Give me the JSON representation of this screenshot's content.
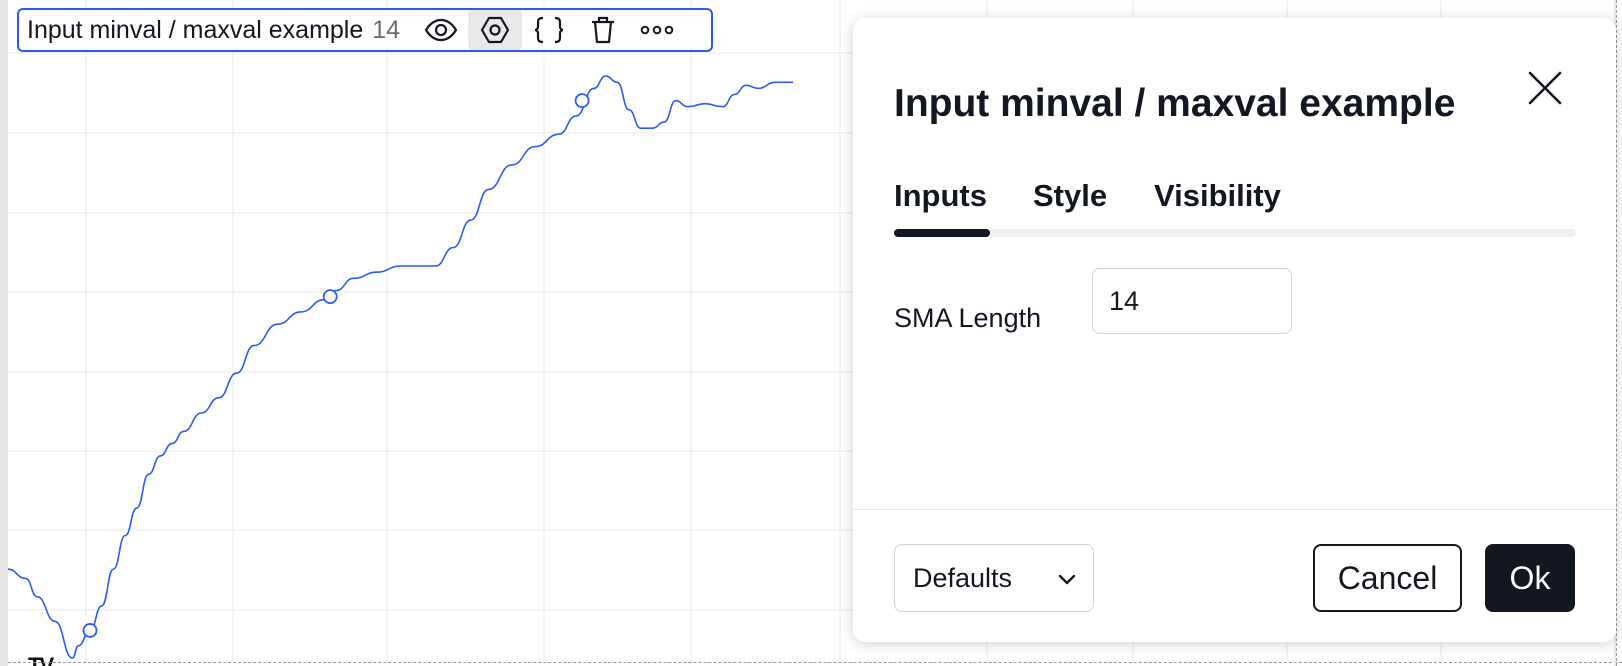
{
  "legend": {
    "title": "Input minval / maxval example",
    "value": "14",
    "buttons": [
      {
        "name": "eye-icon",
        "active": false
      },
      {
        "name": "settings-icon",
        "active": true
      },
      {
        "name": "source-code-icon",
        "active": false
      },
      {
        "name": "trash-icon",
        "active": false
      },
      {
        "name": "more-icon",
        "active": false
      }
    ]
  },
  "chart_data": {
    "type": "line",
    "title": "",
    "series": [
      {
        "color": "#2c5bf0",
        "points": [
          [
            0,
            0.145
          ],
          [
            3,
            0.13
          ],
          [
            5,
            0.1
          ],
          [
            8,
            0.06
          ],
          [
            11,
            0.0
          ],
          [
            12,
            0.02
          ],
          [
            14,
            0.045
          ],
          [
            16,
            0.085
          ],
          [
            18,
            0.145
          ],
          [
            20,
            0.2
          ],
          [
            22,
            0.245
          ],
          [
            24,
            0.3
          ],
          [
            26,
            0.33
          ],
          [
            28,
            0.35
          ],
          [
            30,
            0.37
          ],
          [
            33,
            0.4
          ],
          [
            36,
            0.425
          ],
          [
            39,
            0.465
          ],
          [
            42,
            0.51
          ],
          [
            46,
            0.545
          ],
          [
            50,
            0.565
          ],
          [
            54,
            0.585
          ],
          [
            56,
            0.6
          ],
          [
            59,
            0.62
          ],
          [
            63,
            0.63
          ],
          [
            67,
            0.64
          ],
          [
            70,
            0.64
          ],
          [
            73,
            0.64
          ],
          [
            76,
            0.67
          ],
          [
            79,
            0.715
          ],
          [
            82,
            0.765
          ],
          [
            86,
            0.805
          ],
          [
            90,
            0.835
          ],
          [
            94,
            0.855
          ],
          [
            97,
            0.885
          ],
          [
            100,
            0.93
          ],
          [
            102,
            0.95
          ],
          [
            104,
            0.94
          ],
          [
            106,
            0.895
          ],
          [
            108,
            0.865
          ],
          [
            110,
            0.865
          ],
          [
            112,
            0.875
          ],
          [
            114,
            0.91
          ],
          [
            116,
            0.9
          ],
          [
            119,
            0.905
          ],
          [
            122,
            0.9
          ],
          [
            124,
            0.92
          ],
          [
            126,
            0.935
          ],
          [
            128,
            0.93
          ],
          [
            131,
            0.94
          ],
          [
            134,
            0.94
          ]
        ],
        "markers": [
          [
            14,
            0.045
          ],
          [
            55,
            0.59
          ],
          [
            98,
            0.91
          ]
        ]
      }
    ],
    "xlim": [
      0,
      134
    ],
    "ylim": [
      0,
      0.96
    ],
    "grid": true
  },
  "dialog": {
    "title": "Input minval / maxval example",
    "tabs": [
      "Inputs",
      "Style",
      "Visibility"
    ],
    "active_tab": "Inputs",
    "fields": [
      {
        "label": "SMA Length",
        "value": "14"
      }
    ],
    "defaults_label": "Defaults",
    "cancel_label": "Cancel",
    "ok_label": "Ok"
  },
  "colors": {
    "accent": "#2c5bf0",
    "dark": "#131722",
    "grid": "#e8e8ea"
  }
}
